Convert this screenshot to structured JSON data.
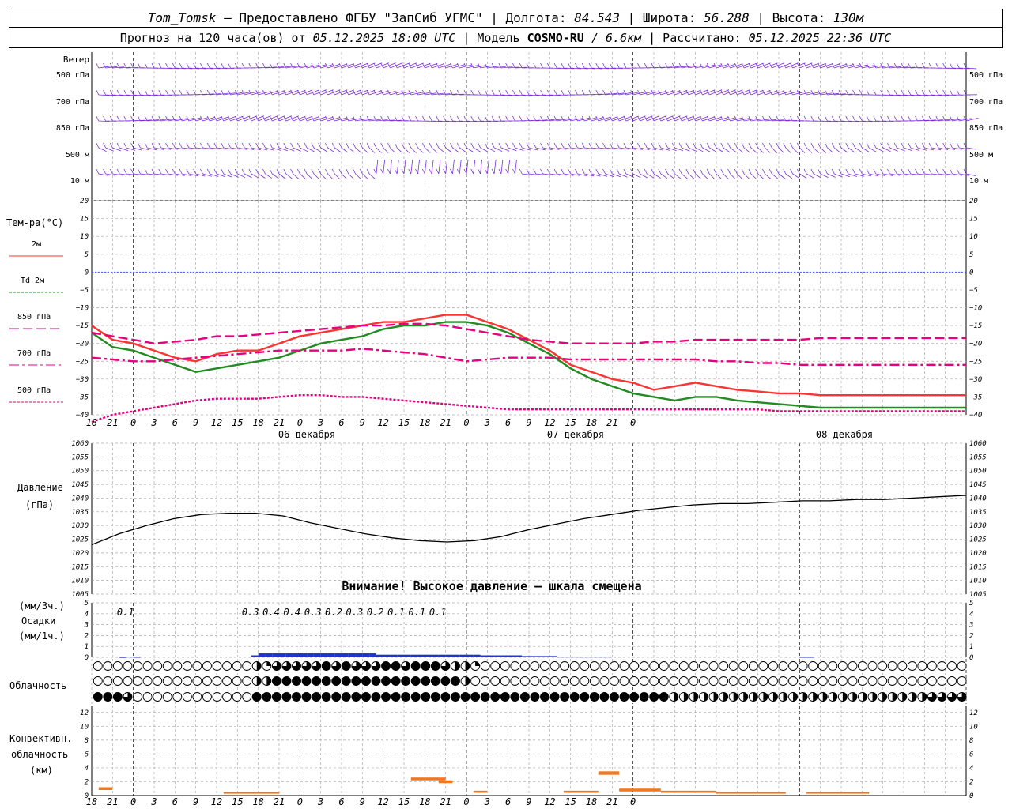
{
  "header": {
    "station": "Tom_Tomsk",
    "provided": "– Предоставлено ФГБУ \"ЗапСиб УГМС\" |",
    "lon_label": "Долгота:",
    "lon": "84.543",
    "lat_label": "| Широта:",
    "lat": "56.288",
    "alt_label": "| Высота:",
    "alt": "130м",
    "forecast_label": "Прогноз на 120 часа(ов) от",
    "forecast_from": "05.12.2025 18:00 UTC",
    "model_label": "| Модель",
    "model": "COSMO-RU",
    "model_res": "/ 6.6км",
    "calc_label": "| Рассчитано:",
    "calc": "05.12.2025 22:36 UTC"
  },
  "wind_panel": {
    "title": "Ветер",
    "levels": [
      "500 гПа",
      "700 гПа",
      "850 гПа",
      "500 м",
      "10  м"
    ]
  },
  "temp_panel": {
    "title": "Тем-ра(°C)",
    "legend": [
      {
        "label": "2м",
        "color": "#ff3333",
        "dash": "solid"
      },
      {
        "label": "Td 2м",
        "color": "#228b22",
        "dash": "dotted"
      },
      {
        "label": "850 гПа",
        "color": "#e6007e",
        "dash": "dashed"
      },
      {
        "label": "700 гПа",
        "color": "#e6007e",
        "dash": "dashdot"
      },
      {
        "label": "500 гПа",
        "color": "#e6007e",
        "dash": "dotted"
      }
    ]
  },
  "pressure_panel": {
    "title": "Давление",
    "unit": "(гПа)",
    "warning": "Внимание! Высокое давление – шкала смещена"
  },
  "precip_panel": {
    "unit3": "(мм/3ч.)",
    "title": "Осадки",
    "unit1": "(мм/1ч.)"
  },
  "cloud_panel": {
    "title": "Облачность"
  },
  "conv_panel": {
    "title1": "Конвективн.",
    "title2": "облачность",
    "unit": "(км)"
  },
  "dates": [
    "06 декабря",
    "07 декабря",
    "08 декабря"
  ],
  "chart_data": [
    {
      "type": "line",
      "name": "temperature",
      "x_hours": [
        0,
        3,
        6,
        9,
        12,
        15,
        18,
        21,
        24,
        27,
        30,
        33,
        36,
        39,
        42,
        45,
        48,
        51,
        54,
        57,
        60,
        63,
        66,
        69,
        72,
        75,
        78,
        81,
        84,
        87,
        90,
        93,
        96,
        99,
        102,
        105,
        108,
        111,
        114,
        117,
        120,
        123,
        126
      ],
      "x_tick_labels": [
        "18",
        "21",
        "0",
        "3",
        "6",
        "9",
        "12",
        "15",
        "18",
        "21",
        "0",
        "3",
        "6",
        "9",
        "12",
        "15",
        "18",
        "21",
        "0",
        "3",
        "6",
        "9",
        "12",
        "15",
        "18",
        "21",
        "0"
      ],
      "ylim": [
        -40,
        20
      ],
      "yticks": [
        -40,
        -35,
        -30,
        -25,
        -20,
        -15,
        -10,
        -5,
        0,
        5,
        10,
        15,
        20
      ],
      "series": [
        {
          "name": "2м",
          "color": "#ff3333",
          "values": [
            -15,
            -19,
            -20,
            -22,
            -24,
            -25,
            -23,
            -22,
            -22,
            -20,
            -18,
            -17,
            -16,
            -15,
            -14,
            -14,
            -13,
            -12,
            -12,
            -14,
            -16,
            -19,
            -22,
            -26,
            -28,
            -30,
            -31,
            -33,
            -32,
            -31,
            -32,
            -33,
            -33.5,
            -34,
            -34,
            -34.5,
            -34.5,
            -34.5,
            -34.5,
            -34.5,
            -34.5,
            -34.5,
            -34.5
          ]
        },
        {
          "name": "Td 2м",
          "color": "#228b22",
          "values": [
            -17,
            -21,
            -22,
            -24,
            -26,
            -28,
            -27,
            -26,
            -25,
            -24,
            -22,
            -20,
            -19,
            -18,
            -16,
            -15,
            -15,
            -14,
            -14,
            -15,
            -17,
            -20,
            -23,
            -27,
            -30,
            -32,
            -34,
            -35,
            -36,
            -35,
            -35,
            -36,
            -36.5,
            -37,
            -37.5,
            -38,
            -38,
            -38,
            -38,
            -38,
            -38,
            -38,
            -38
          ]
        },
        {
          "name": "850 гПа",
          "color": "#e6007e",
          "dash": "dashed",
          "values": [
            -17,
            -18,
            -19,
            -20,
            -19.5,
            -19,
            -18,
            -18,
            -17.5,
            -17,
            -16.5,
            -16,
            -15.5,
            -15,
            -15,
            -14.5,
            -14.5,
            -15,
            -16,
            -17,
            -18,
            -19,
            -19.5,
            -20,
            -20,
            -20,
            -20,
            -19.5,
            -19.5,
            -19,
            -19,
            -19,
            -19,
            -19,
            -19,
            -18.5,
            -18.5,
            -18.5,
            -18.5,
            -18.5,
            -18.5,
            -18.5,
            -18.5
          ]
        },
        {
          "name": "700 гПа",
          "color": "#e6007e",
          "dash": "dashdot",
          "values": [
            -24,
            -24.5,
            -25,
            -25,
            -24.5,
            -24,
            -23.5,
            -23,
            -22.5,
            -22,
            -22,
            -22,
            -22,
            -21.5,
            -22,
            -22.5,
            -23,
            -24,
            -25,
            -24.5,
            -24,
            -24,
            -24,
            -24.5,
            -24.5,
            -24.5,
            -24.5,
            -24.5,
            -24.5,
            -24.5,
            -25,
            -25,
            -25.5,
            -25.5,
            -26,
            -26,
            -26,
            -26,
            -26,
            -26,
            -26,
            -26,
            -26
          ]
        },
        {
          "name": "500 гПа",
          "color": "#e6007e",
          "dash": "dotted",
          "values": [
            -42,
            -40,
            -39,
            -38,
            -37,
            -36,
            -35.5,
            -35.5,
            -35.5,
            -35,
            -34.5,
            -34.5,
            -35,
            -35,
            -35.5,
            -36,
            -36.5,
            -37,
            -37.5,
            -38,
            -38.5,
            -38.5,
            -38.5,
            -38.5,
            -38.5,
            -38.5,
            -38.5,
            -38.5,
            -38.5,
            -38.5,
            -38.5,
            -38.5,
            -38.5,
            -39,
            -39,
            -39,
            -39,
            -39,
            -39,
            -39,
            -39,
            -39,
            -39
          ]
        }
      ]
    },
    {
      "type": "line",
      "name": "pressure",
      "ylim": [
        1005,
        1060
      ],
      "yticks": [
        1005,
        1010,
        1015,
        1020,
        1025,
        1030,
        1035,
        1040,
        1045,
        1050,
        1055,
        1060
      ],
      "series": [
        {
          "name": "Давление",
          "color": "#000000",
          "values": [
            1023,
            1027,
            1030,
            1032.5,
            1034,
            1034.5,
            1034.5,
            1033.5,
            1031,
            1029,
            1027,
            1025.5,
            1024.5,
            1024,
            1024.5,
            1026,
            1028.5,
            1030.5,
            1032.5,
            1034,
            1035.5,
            1036.5,
            1037.5,
            1038,
            1038,
            1038.5,
            1039,
            1039,
            1039.5,
            1039.5,
            1040,
            1040.5,
            1041
          ]
        }
      ]
    },
    {
      "type": "bar",
      "name": "precipitation",
      "ylim": [
        0,
        5
      ],
      "yticks": [
        0,
        1,
        2,
        3,
        4,
        5
      ],
      "labels_3h": [
        {
          "x_hours": 6,
          "label": "0.1"
        },
        {
          "x_hours": 24,
          "label": "0.3"
        },
        {
          "x_hours": 27,
          "label": "0.4"
        },
        {
          "x_hours": 30,
          "label": "0.4"
        },
        {
          "x_hours": 33,
          "label": "0.3"
        },
        {
          "x_hours": 36,
          "label": "0.2"
        },
        {
          "x_hours": 39,
          "label": "0.3"
        },
        {
          "x_hours": 42,
          "label": "0.2"
        },
        {
          "x_hours": 45,
          "label": "0.1"
        },
        {
          "x_hours": 48,
          "label": "0.1"
        },
        {
          "x_hours": 51,
          "label": "0.1"
        }
      ],
      "hourly_values": [
        0,
        0,
        0,
        0,
        0.02,
        0.05,
        0.03,
        0,
        0,
        0,
        0,
        0,
        0,
        0,
        0,
        0,
        0,
        0,
        0,
        0,
        0,
        0,
        0,
        0.15,
        0.3,
        0.3,
        0.3,
        0.3,
        0.3,
        0.3,
        0.3,
        0.3,
        0.3,
        0.3,
        0.3,
        0.3,
        0.3,
        0.3,
        0.3,
        0.3,
        0.3,
        0.2,
        0.2,
        0.2,
        0.2,
        0.2,
        0.2,
        0.2,
        0.2,
        0.2,
        0.2,
        0.2,
        0.2,
        0.2,
        0.2,
        0.2,
        0.15,
        0.15,
        0.15,
        0.15,
        0.15,
        0.15,
        0.1,
        0.1,
        0.1,
        0.1,
        0.1,
        0.05,
        0.05,
        0.05,
        0.05,
        0.05,
        0.05,
        0.05,
        0.05,
        0,
        0,
        0,
        0,
        0,
        0,
        0,
        0,
        0,
        0,
        0,
        0,
        0,
        0,
        0,
        0,
        0,
        0,
        0,
        0,
        0,
        0,
        0,
        0,
        0,
        0,
        0,
        0.03,
        0.03,
        0,
        0,
        0,
        0,
        0,
        0,
        0,
        0,
        0,
        0,
        0,
        0,
        0,
        0,
        0,
        0,
        0,
        0,
        0,
        0,
        0,
        0,
        0,
        0,
        0,
        0,
        0,
        0
      ]
    },
    {
      "type": "heatmap",
      "name": "cloudiness",
      "rows": [
        "upper",
        "middle",
        "lower"
      ],
      "values_upper": [
        0,
        0,
        0,
        0,
        0,
        0,
        0,
        0,
        0,
        0,
        0,
        0,
        0,
        0,
        0,
        0,
        0,
        0,
        0,
        0,
        0,
        0,
        0,
        0,
        2,
        1,
        2,
        3,
        3,
        4,
        3,
        3,
        3,
        3,
        4,
        3,
        3,
        4,
        3,
        4,
        3,
        3,
        4,
        4,
        4,
        3,
        3,
        4,
        4,
        4,
        4,
        3,
        3,
        2,
        2,
        1,
        0,
        0,
        0,
        0,
        0,
        0,
        0,
        0,
        0,
        0,
        0,
        0,
        0,
        0,
        0,
        0,
        0,
        0,
        0,
        0,
        0,
        0,
        0,
        0,
        0,
        0,
        0,
        0,
        0,
        0,
        0,
        0,
        0,
        0,
        0,
        0,
        0,
        0,
        0,
        0,
        0,
        0,
        0,
        0,
        0,
        0,
        0,
        0,
        0,
        0,
        0,
        0,
        0,
        0,
        0,
        0,
        0,
        0,
        0,
        0,
        0,
        0,
        0,
        0,
        0,
        0,
        0,
        0,
        0,
        0,
        0,
        0
      ],
      "values_middle": [
        0,
        0,
        0,
        0,
        0,
        0,
        0,
        0,
        0,
        0,
        0,
        0,
        0,
        0,
        0,
        0,
        0,
        0,
        0,
        0,
        0,
        0,
        0,
        2,
        2,
        2,
        4,
        4,
        4,
        4,
        4,
        4,
        4,
        4,
        4,
        4,
        4,
        4,
        4,
        4,
        4,
        4,
        4,
        4,
        4,
        4,
        4,
        4,
        4,
        4,
        4,
        4,
        4,
        4,
        2,
        0,
        0,
        0,
        0,
        0,
        0,
        0,
        0,
        0,
        0,
        0,
        0,
        0,
        0,
        0,
        0,
        0,
        0,
        0,
        0,
        0,
        0,
        0,
        0,
        0,
        0,
        0,
        0,
        0,
        0,
        0,
        0,
        0,
        0,
        0,
        0,
        0,
        0,
        0,
        0,
        0,
        0,
        0,
        0,
        0,
        0,
        0,
        0,
        0,
        0,
        0,
        0,
        0,
        0,
        0,
        0,
        0,
        0,
        0,
        0,
        0,
        0,
        0,
        0,
        0,
        0,
        0,
        0,
        0,
        0,
        0,
        0,
        0
      ],
      "values_lower": [
        1,
        4,
        4,
        4,
        4,
        3,
        1,
        0,
        0,
        0,
        0,
        0,
        0,
        0,
        0,
        0,
        0,
        0,
        0,
        0,
        0,
        0,
        0,
        0,
        4,
        4,
        4,
        4,
        4,
        4,
        4,
        4,
        4,
        4,
        4,
        4,
        4,
        4,
        4,
        4,
        4,
        4,
        4,
        4,
        4,
        4,
        4,
        4,
        4,
        4,
        4,
        4,
        4,
        4,
        4,
        4,
        4,
        4,
        4,
        4,
        4,
        4,
        4,
        4,
        4,
        4,
        4,
        4,
        4,
        4,
        4,
        4,
        4,
        4,
        4,
        4,
        4,
        4,
        4,
        4,
        4,
        4,
        4,
        4,
        2,
        2,
        2,
        2,
        2,
        2,
        2,
        2,
        2,
        2,
        2,
        2,
        2,
        2,
        2,
        2,
        2,
        2,
        2,
        2,
        2,
        2,
        2,
        2,
        2,
        2,
        2,
        2,
        2,
        2,
        2,
        2,
        2,
        2,
        2,
        2,
        2,
        3,
        3,
        3,
        3,
        3,
        3,
        3
      ]
    },
    {
      "type": "bar",
      "name": "convective_clouds",
      "ylim": [
        0,
        13
      ],
      "yticks": [
        0,
        2,
        4,
        6,
        8,
        10,
        12
      ],
      "segments": [
        {
          "x0": 1,
          "x1": 3,
          "base": 0.8,
          "top": 1.2
        },
        {
          "x0": 19,
          "x1": 27,
          "base": 0.3,
          "top": 0.5
        },
        {
          "x0": 46,
          "x1": 51,
          "base": 2.2,
          "top": 2.6
        },
        {
          "x0": 50,
          "x1": 52,
          "base": 1.8,
          "top": 2.2
        },
        {
          "x0": 55,
          "x1": 57,
          "base": 0.4,
          "top": 0.7
        },
        {
          "x0": 68,
          "x1": 73,
          "base": 0.4,
          "top": 0.7
        },
        {
          "x0": 73,
          "x1": 76,
          "base": 3.0,
          "top": 3.5
        },
        {
          "x0": 76,
          "x1": 82,
          "base": 0.6,
          "top": 1.0
        },
        {
          "x0": 82,
          "x1": 90,
          "base": 0.4,
          "top": 0.7
        },
        {
          "x0": 90,
          "x1": 100,
          "base": 0.3,
          "top": 0.5
        },
        {
          "x0": 103,
          "x1": 112,
          "base": 0.3,
          "top": 0.5
        }
      ]
    }
  ],
  "colors": {
    "wind": "#7b2be2",
    "grid": "#aaaaaa",
    "zero": "#3355ff",
    "precip": "#2233cc",
    "conv": "#ee7722"
  }
}
